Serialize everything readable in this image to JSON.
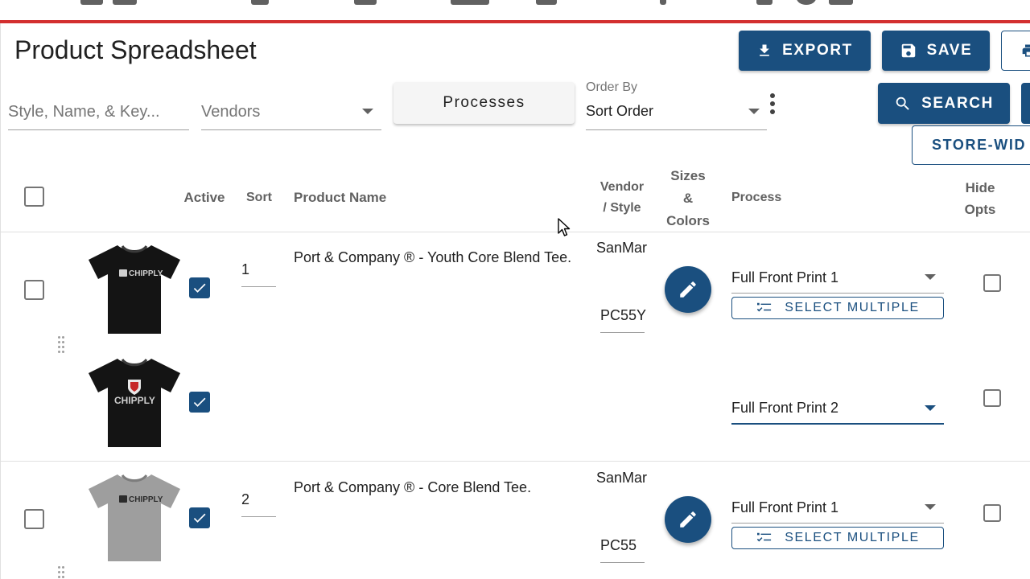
{
  "page": {
    "title": "Product Spreadsheet"
  },
  "toolbar": {
    "export_label": "EXPORT",
    "save_label": "SAVE",
    "search_label": "SEARCH",
    "store_wide_label": "STORE-WID"
  },
  "filters": {
    "search_placeholder": "Style, Name, & Key...",
    "vendors_placeholder": "Vendors",
    "processes_label": "Processes",
    "order_by_label": "Order By",
    "order_by_value": "Sort Order"
  },
  "table": {
    "headers": {
      "active": "Active",
      "sort": "Sort",
      "product_name": "Product Name",
      "vendor_style_1": "Vendor",
      "vendor_style_2": "/ Style",
      "sizes_colors_1": "Sizes",
      "sizes_colors_2": "&",
      "sizes_colors_3": "Colors",
      "process": "Process",
      "hide_opts_1": "Hide",
      "hide_opts_2": "Opts"
    },
    "rows": [
      {
        "sort": "1",
        "product_name": "Port & Company ® - Youth Core Blend Tee.",
        "vendor": "SanMar",
        "style": "PC55Y",
        "process_1": "Full Front Print 1",
        "process_2": "Full Front Print 2",
        "select_multiple": "SELECT MULTIPLE",
        "shirt_color": "#141414"
      },
      {
        "sort": "2",
        "product_name": "Port & Company ® - Core Blend Tee.",
        "vendor": "SanMar",
        "style": "PC55",
        "process_1": "Full Front Print 1",
        "select_multiple": "SELECT MULTIPLE",
        "shirt_color": "#9e9e9e"
      }
    ]
  },
  "colors": {
    "primary": "#1a4f7f",
    "accent_bar": "#d32f2f"
  }
}
